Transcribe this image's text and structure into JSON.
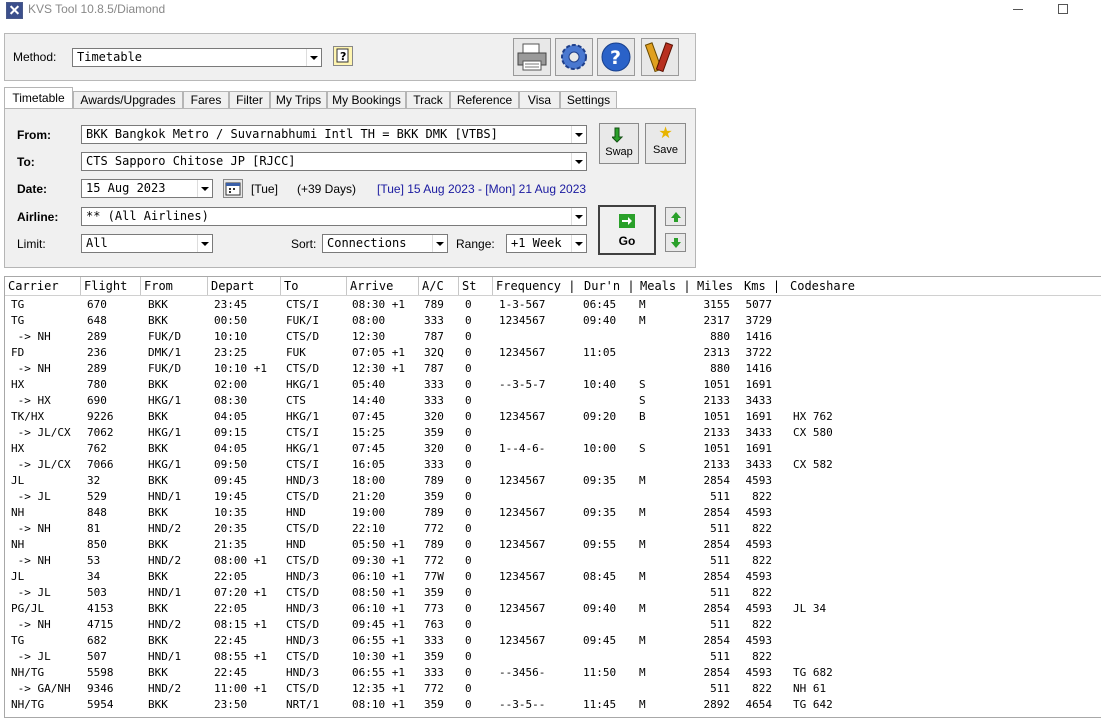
{
  "window": {
    "title": "KVS Tool 10.8.5/Diamond"
  },
  "method": {
    "label": "Method:",
    "value": "Timetable"
  },
  "toolbar_icons": [
    "printer-icon",
    "settings-icon",
    "help-icon",
    "tools-icon"
  ],
  "tabs": [
    "Timetable",
    "Awards/Upgrades",
    "Fares",
    "Filter",
    "My Trips",
    "My Bookings",
    "Track",
    "Reference",
    "Visa",
    "Settings"
  ],
  "form": {
    "from_label": "From:",
    "from_value": "BKK  Bangkok Metro / Suvarnabhumi Intl TH = BKK DMK [VTBS]",
    "to_label": "To:",
    "to_value": "CTS  Sapporo Chitose JP [RJCC]",
    "date_label": "Date:",
    "date_value": "15 Aug 2023",
    "date_day": "[Tue]",
    "date_offset": "(+39 Days)",
    "date_range": "[Tue] 15 Aug 2023 - [Mon] 21 Aug 2023",
    "airline_label": "Airline:",
    "airline_value": "**  (All Airlines)",
    "limit_label": "Limit:",
    "limit_value": "All",
    "sort_label": "Sort:",
    "sort_value": "Connections",
    "range_label": "Range:",
    "range_value": "+1 Week",
    "swap_label": "Swap",
    "save_label": "Save",
    "go_label": "Go"
  },
  "table": {
    "headers": [
      "Carrier",
      "Flight",
      "From",
      "Depart",
      "To",
      "Arrive",
      "A/C",
      "St",
      "Frequency |",
      "Dur'n |",
      "Meals |",
      "Miles",
      "Kms |",
      "Codeshare"
    ],
    "rows": [
      [
        "TG",
        "670",
        "BKK",
        "23:45",
        "CTS/I",
        "08:30 +1",
        "789",
        "0",
        "1-3-567",
        "06:45",
        "M",
        "3155",
        "5077",
        ""
      ],
      [
        "TG",
        "648",
        "BKK",
        "00:50",
        "FUK/I",
        "08:00",
        "333",
        "0",
        "1234567",
        "09:40",
        "M",
        "2317",
        "3729",
        ""
      ],
      [
        " -> NH",
        "289",
        "FUK/D",
        "10:10",
        "CTS/D",
        "12:30",
        "787",
        "0",
        "",
        "",
        "",
        "880",
        "1416",
        ""
      ],
      [
        "FD",
        "236",
        "DMK/1",
        "23:25",
        "FUK",
        "07:05 +1",
        "32Q",
        "0",
        "1234567",
        "11:05",
        "",
        "2313",
        "3722",
        ""
      ],
      [
        " -> NH",
        "289",
        "FUK/D",
        "10:10 +1",
        "CTS/D",
        "12:30 +1",
        "787",
        "0",
        "",
        "",
        "",
        "880",
        "1416",
        ""
      ],
      [
        "HX",
        "780",
        "BKK",
        "02:00",
        "HKG/1",
        "05:40",
        "333",
        "0",
        "--3-5-7",
        "10:40",
        "S",
        "1051",
        "1691",
        ""
      ],
      [
        " -> HX",
        "690",
        "HKG/1",
        "08:30",
        "CTS",
        "14:40",
        "333",
        "0",
        "",
        "",
        "S",
        "2133",
        "3433",
        ""
      ],
      [
        "TK/HX",
        "9226",
        "BKK",
        "04:05",
        "HKG/1",
        "07:45",
        "320",
        "0",
        "1234567",
        "09:20",
        "B",
        "1051",
        "1691",
        "HX 762"
      ],
      [
        " -> JL/CX",
        "7062",
        "HKG/1",
        "09:15",
        "CTS/I",
        "15:25",
        "359",
        "0",
        "",
        "",
        "",
        "2133",
        "3433",
        "CX 580"
      ],
      [
        "HX",
        "762",
        "BKK",
        "04:05",
        "HKG/1",
        "07:45",
        "320",
        "0",
        "1--4-6-",
        "10:00",
        "S",
        "1051",
        "1691",
        ""
      ],
      [
        " -> JL/CX",
        "7066",
        "HKG/1",
        "09:50",
        "CTS/I",
        "16:05",
        "333",
        "0",
        "",
        "",
        "",
        "2133",
        "3433",
        "CX 582"
      ],
      [
        "JL",
        "32",
        "BKK",
        "09:45",
        "HND/3",
        "18:00",
        "789",
        "0",
        "1234567",
        "09:35",
        "M",
        "2854",
        "4593",
        ""
      ],
      [
        " -> JL",
        "529",
        "HND/1",
        "19:45",
        "CTS/D",
        "21:20",
        "359",
        "0",
        "",
        "",
        "",
        "511",
        "822",
        ""
      ],
      [
        "NH",
        "848",
        "BKK",
        "10:35",
        "HND",
        "19:00",
        "789",
        "0",
        "1234567",
        "09:35",
        "M",
        "2854",
        "4593",
        ""
      ],
      [
        " -> NH",
        "81",
        "HND/2",
        "20:35",
        "CTS/D",
        "22:10",
        "772",
        "0",
        "",
        "",
        "",
        "511",
        "822",
        ""
      ],
      [
        "NH",
        "850",
        "BKK",
        "21:35",
        "HND",
        "05:50 +1",
        "789",
        "0",
        "1234567",
        "09:55",
        "M",
        "2854",
        "4593",
        ""
      ],
      [
        " -> NH",
        "53",
        "HND/2",
        "08:00 +1",
        "CTS/D",
        "09:30 +1",
        "772",
        "0",
        "",
        "",
        "",
        "511",
        "822",
        ""
      ],
      [
        "JL",
        "34",
        "BKK",
        "22:05",
        "HND/3",
        "06:10 +1",
        "77W",
        "0",
        "1234567",
        "08:45",
        "M",
        "2854",
        "4593",
        ""
      ],
      [
        " -> JL",
        "503",
        "HND/1",
        "07:20 +1",
        "CTS/D",
        "08:50 +1",
        "359",
        "0",
        "",
        "",
        "",
        "511",
        "822",
        ""
      ],
      [
        "PG/JL",
        "4153",
        "BKK",
        "22:05",
        "HND/3",
        "06:10 +1",
        "773",
        "0",
        "1234567",
        "09:40",
        "M",
        "2854",
        "4593",
        "JL 34"
      ],
      [
        " -> NH",
        "4715",
        "HND/2",
        "08:15 +1",
        "CTS/D",
        "09:45 +1",
        "763",
        "0",
        "",
        "",
        "",
        "511",
        "822",
        ""
      ],
      [
        "TG",
        "682",
        "BKK",
        "22:45",
        "HND/3",
        "06:55 +1",
        "333",
        "0",
        "1234567",
        "09:45",
        "M",
        "2854",
        "4593",
        ""
      ],
      [
        " -> JL",
        "507",
        "HND/1",
        "08:55 +1",
        "CTS/D",
        "10:30 +1",
        "359",
        "0",
        "",
        "",
        "",
        "511",
        "822",
        ""
      ],
      [
        "NH/TG",
        "5598",
        "BKK",
        "22:45",
        "HND/3",
        "06:55 +1",
        "333",
        "0",
        "--3456-",
        "11:50",
        "M",
        "2854",
        "4593",
        "TG 682"
      ],
      [
        " -> GA/NH",
        "9346",
        "HND/2",
        "11:00 +1",
        "CTS/D",
        "12:35 +1",
        "772",
        "0",
        "",
        "",
        "",
        "511",
        "822",
        "NH 61"
      ],
      [
        "NH/TG",
        "5954",
        "BKK",
        "23:50",
        "NRT/1",
        "08:10 +1",
        "359",
        "0",
        "--3-5--",
        "11:45",
        "M",
        "2892",
        "4654",
        "TG 642"
      ]
    ]
  }
}
